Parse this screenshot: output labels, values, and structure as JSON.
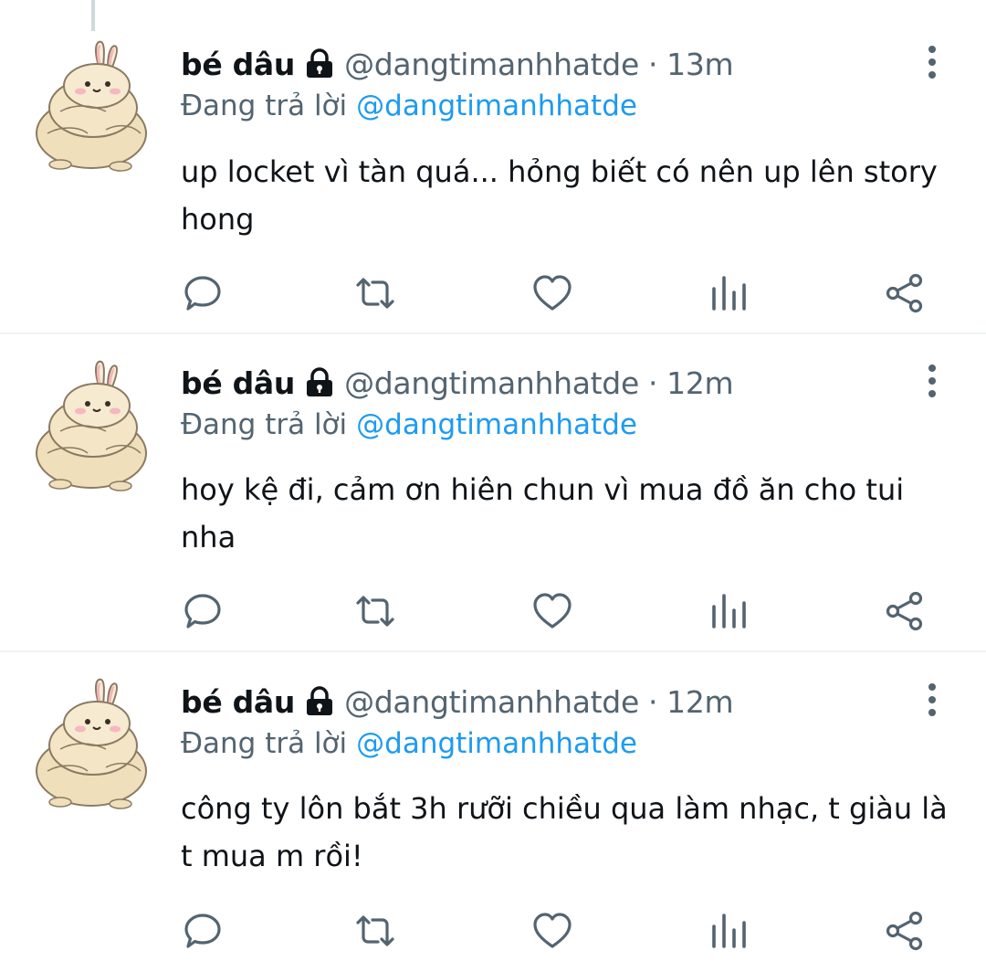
{
  "tweets": [
    {
      "display_name": "bé dâu",
      "handle": "@dangtimanhhatde",
      "separator": "·",
      "time": "13m",
      "reply_prefix": "Đang trả lời",
      "reply_to": "@dangtimanhhatde",
      "text": "up locket vì tàn quá... hỏng biết có nên up lên story hong"
    },
    {
      "display_name": "bé dâu",
      "handle": "@dangtimanhhatde",
      "separator": "·",
      "time": "12m",
      "reply_prefix": "Đang trả lời",
      "reply_to": "@dangtimanhhatde",
      "text": "hoy kệ đi, cảm ơn hiên chun vì mua đồ ăn cho tui nha"
    },
    {
      "display_name": "bé dâu",
      "handle": "@dangtimanhhatde",
      "separator": "·",
      "time": "12m",
      "reply_prefix": "Đang trả lời",
      "reply_to": "@dangtimanhhatde",
      "text": "công ty lôn bắt 3h rưỡi chiều qua làm nhạc, t giàu là t mua m rồi!"
    }
  ],
  "icons": {
    "avatar": "bunny-avatar",
    "lock": "lock-icon",
    "more": "more-vertical-icon",
    "reply": "reply-icon",
    "retweet": "retweet-icon",
    "like": "heart-icon",
    "views": "bar-chart-icon",
    "share": "share-icon"
  },
  "colors": {
    "text": "#0f1419",
    "secondary": "#536471",
    "link": "#1d9bf0",
    "divider": "#eff3f4"
  }
}
